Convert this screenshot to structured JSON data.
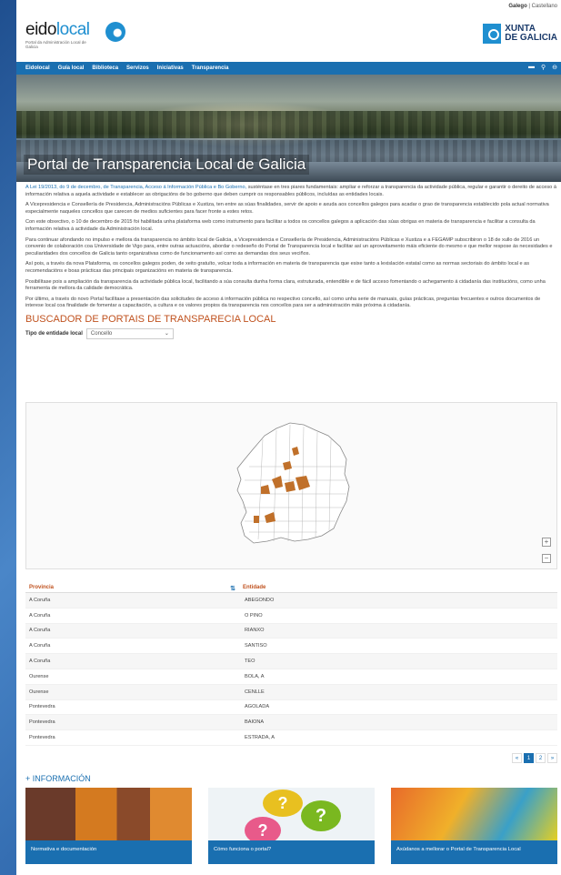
{
  "header": {
    "languages": [
      "Galego",
      "Castellano"
    ],
    "logo_text_dark": "eido",
    "logo_text_blue": "local",
    "logo_subtitle": "Portal da Administración Local de Galicia",
    "xunta_line1": "XUNTA",
    "xunta_line2": "DE GALICIA"
  },
  "nav": {
    "items": [
      "Eidolocal",
      "Guía local",
      "Biblioteca",
      "Servizos",
      "Iniciativas",
      "Transparencia"
    ],
    "icons": [
      "menu-icon",
      "search-icon",
      "user-icon"
    ]
  },
  "hero": {
    "title": "Portal de Transparencia Local de Galicia"
  },
  "intro": {
    "p1_link": "A Lei 19/2013, do 9 de decembro, de Transparencia, Acceso á Información Pública e Bo Goberno,",
    "p1_rest": " susténtase en tres piares fundamentais: ampliar e reforzar a transparencia da actividade pública, regular e garantir o dereito de acceso á información relativa a aquela actividade e establecer as obrigacións de bo goberno que deben cumprir os responsables públicos, incluídas as entidades locais.",
    "p2": "A Vicepresidencia e Consellería de Presidencia, Administracións Públicas e Xustiza, ten entre as súas finalidades, servir de apoio e axuda aos concellos galegos para acadar o grao de transparencia establecido pola actual normativa especialmente naqueles concellos que carecen de medios suficientes para facer fronte a estes retos.",
    "p3": "Con este obxectivo, o 10 de decembro de 2015 foi habilitada unha plataforma web como instrumento para facilitar a todos os concellos galegos a aplicación das súas obrigas en materia de transparencia e facilitar a consulta da información relativa á actividade da Administración local.",
    "p4": "Para continuar afondando no impulso e mellora da transparencia no ámbito local de Galicia, a Vicepresidencia e Consellería de Presidencia, Administracións Públicas e Xustiza e a FEGAMP subscribiron o 18 de xullo de 2016 un convenio de colaboración coa Universidade de Vigo para, entre outras actuacións, abordar o redeseño do Portal de Transparencia local e facilitar así un aproveitamento máis eficiente do mesmo e que mellor respose ás necesidades e peculiaridades dos concellos de Galicia tanto organizativas como de funcionamento así como as demandas dos seus veciños.",
    "p5": "Así pois, a través da nova Plataforma, os concellos galegos poden, de xeito gratuíto, volcar toda a información en materia de transparencia que esixe tanto a lexislación estatal como as normas sectoriais do ámbito local e as recomendacións e boas prácticas das principais organizacións en materia de transparencia.",
    "p6": "Posibilítase pois a ampliación da transparencia da actividade pública local, facilitando a súa consulta dunha forma clara, estruturada, entendible e de fácil acceso fomentando o achegamento á cidadanía das institucións, como unha ferramenta de mellora da calidade democrática.",
    "p7": "Por último, a través do novo Portal facilítase a presentación das solicitudes de acceso á información pública no respectivo concello, así como unha serie de manuais, guías prácticas, preguntas frecuentes e outros documentos de interese local coa finalidade de fomentar a capacitación, a cultura e os valores propios da transparencia nos concellos para ser a administración máis próxima á cidadanía."
  },
  "search": {
    "title": "BUSCADOR DE PORTAIS DE TRANSPARECIA LOCAL",
    "filter_label": "Tipo de entidade local",
    "filter_value": "Concello"
  },
  "map": {
    "zoom_in": "+",
    "zoom_out": "−"
  },
  "table": {
    "col_provincia": "Provincia",
    "col_entidade": "Entidade",
    "rows": [
      {
        "provincia": "A Coruña",
        "entidade": "ABEGONDO"
      },
      {
        "provincia": "A Coruña",
        "entidade": "O PINO"
      },
      {
        "provincia": "A Coruña",
        "entidade": "RIANXO"
      },
      {
        "provincia": "A Coruña",
        "entidade": "SANTISO"
      },
      {
        "provincia": "A Coruña",
        "entidade": "TEO"
      },
      {
        "provincia": "Ourense",
        "entidade": "BOLA, A"
      },
      {
        "provincia": "Ourense",
        "entidade": "CENLLE"
      },
      {
        "provincia": "Pontevedra",
        "entidade": "AGOLADA"
      },
      {
        "provincia": "Pontevedra",
        "entidade": "BAIONA"
      },
      {
        "provincia": "Pontevedra",
        "entidade": "ESTRADA, A"
      }
    ]
  },
  "pagination": {
    "prev": "«",
    "pages": [
      "1",
      "2"
    ],
    "next": "»",
    "current": "1"
  },
  "info": {
    "title": "+ INFORMACIÓN",
    "cards": [
      "Normativa e documentación",
      "Cómo funciona o portal?",
      "Axúdanos a mellorar o Portal de Transparencia Local"
    ]
  },
  "colors": {
    "accent": "#1a6fb0",
    "section": "#c0521f",
    "highlight_council": "#c0702a"
  }
}
